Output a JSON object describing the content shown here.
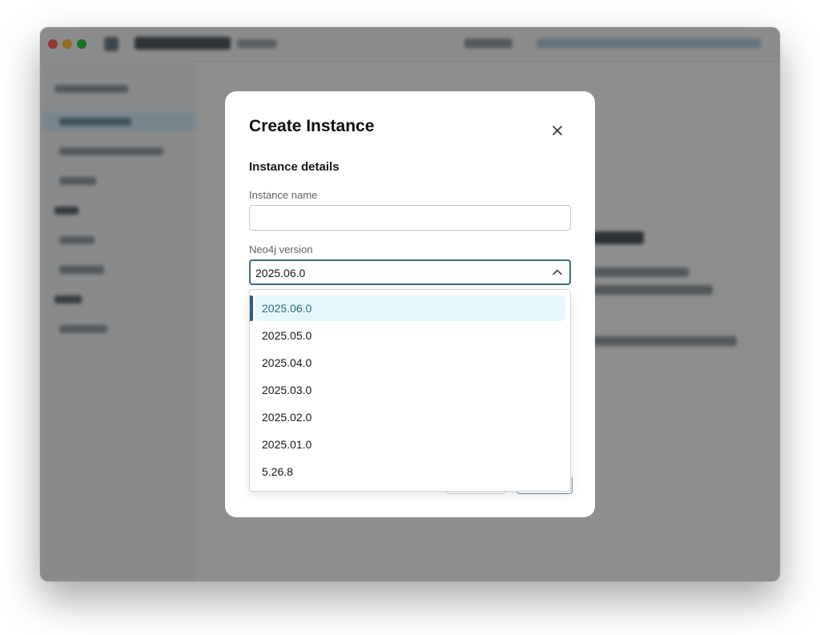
{
  "modal": {
    "title": "Create Instance",
    "section_title": "Instance details",
    "instance_name_label": "Instance name",
    "instance_name_value": "",
    "version_label": "Neo4j version",
    "version_selected": "2025.06.0",
    "close_icon": "close-icon",
    "chevron_icon": "chevron-up-icon"
  },
  "dropdown": {
    "options": [
      "2025.06.0",
      "2025.05.0",
      "2025.04.0",
      "2025.03.0",
      "2025.02.0",
      "2025.01.0",
      "5.26.8"
    ],
    "selected_index": 0
  },
  "colors": {
    "accent": "#3d6d85",
    "selected_bg": "#e6f7fa",
    "selected_text": "#2e6986",
    "overlay": "#7a7a7a"
  }
}
